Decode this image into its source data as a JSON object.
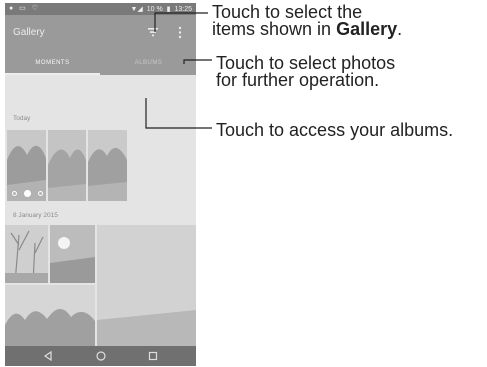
{
  "status_bar": {
    "battery_text": "10 %",
    "time": "13:25"
  },
  "app_bar": {
    "title": "Gallery"
  },
  "tabs": [
    {
      "label": "MOMENTS"
    },
    {
      "label": "ALBUMS"
    }
  ],
  "sections": [
    {
      "label": "Today"
    },
    {
      "label": "8 January 2015"
    }
  ],
  "callouts": {
    "filter_line1": "Touch to select the",
    "filter_line2_prefix": "items shown in ",
    "filter_line2_bold": "Gallery",
    "filter_line2_suffix": ".",
    "menu_line1": "Touch to select photos",
    "menu_line2": "for further operation.",
    "albums": "Touch to access your albums."
  },
  "icons": {
    "filter": "filter-icon",
    "menu": "more-vert-icon",
    "back": "back-triangle-icon",
    "home": "home-circle-icon",
    "recents": "recents-square-icon"
  },
  "colors": {
    "status_bar": "#7a7a7a",
    "app_bar": "#9a9a9a",
    "nav_bar": "#707070"
  }
}
